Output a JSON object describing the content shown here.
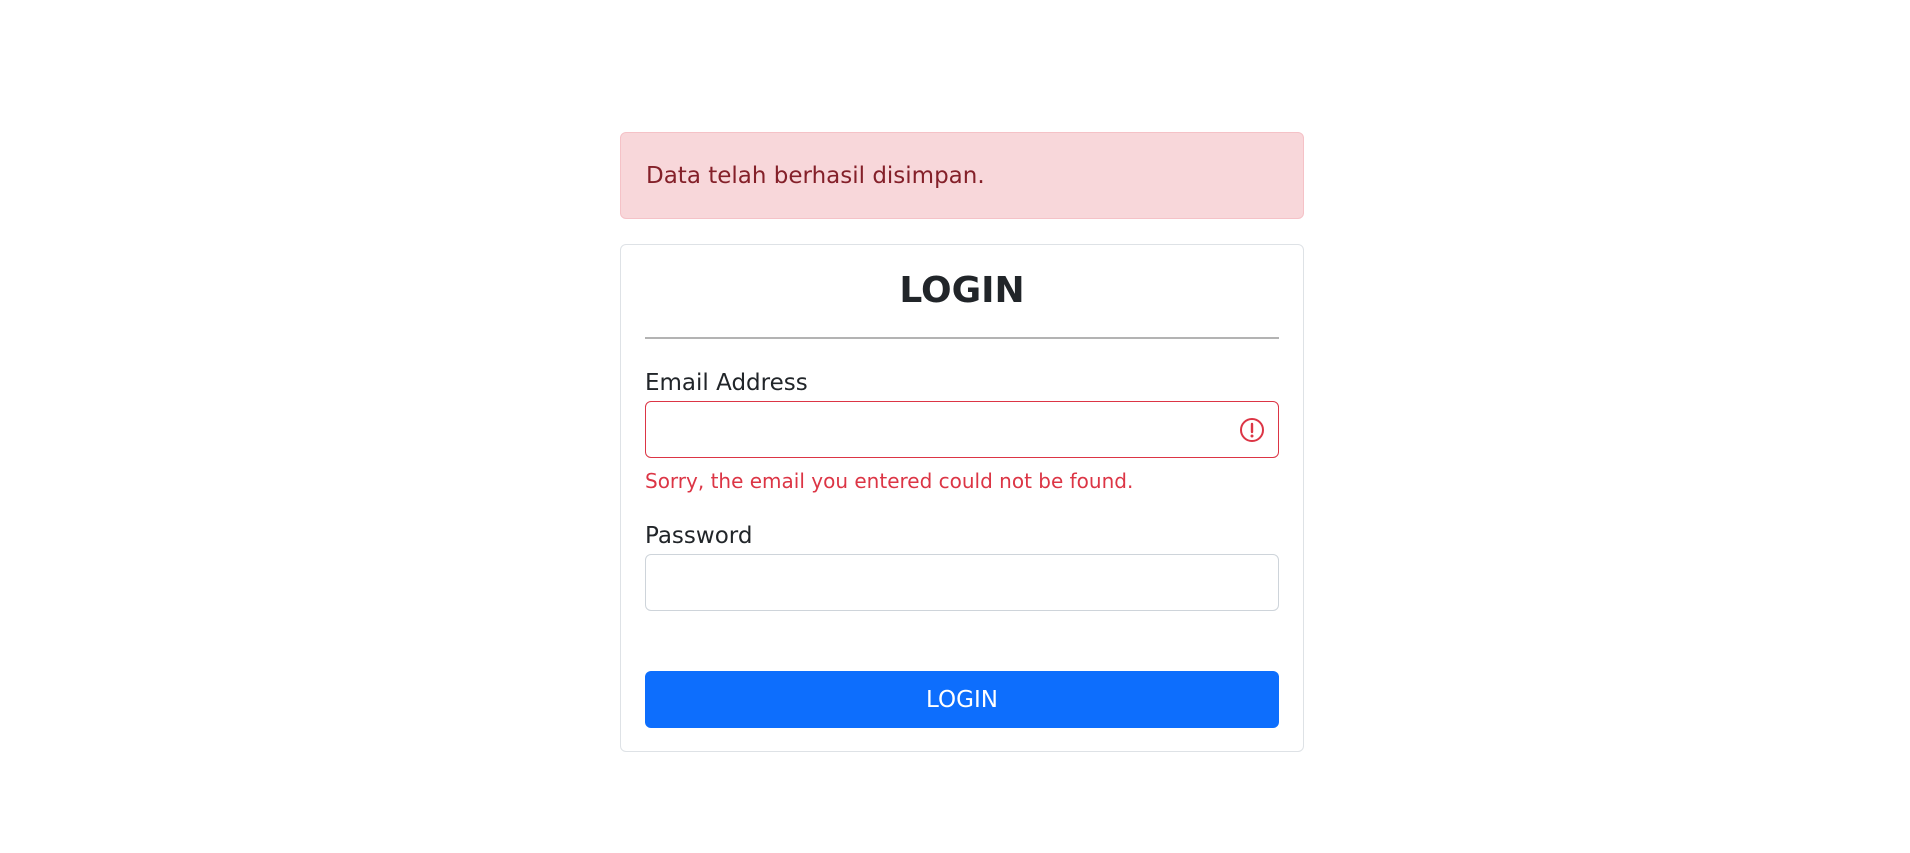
{
  "alert": {
    "message": "Data telah berhasil disimpan."
  },
  "login_card": {
    "title": "LOGIN",
    "email": {
      "label": "Email Address",
      "value": "",
      "error": "Sorry, the email you entered could not be found.",
      "icon": "exclamation-circle-icon"
    },
    "password": {
      "label": "Password",
      "value": ""
    },
    "submit_label": "LOGIN"
  },
  "colors": {
    "alert_bg": "#f8d7da",
    "alert_text": "#842029",
    "danger": "#dc3545",
    "primary": "#0d6efd"
  }
}
